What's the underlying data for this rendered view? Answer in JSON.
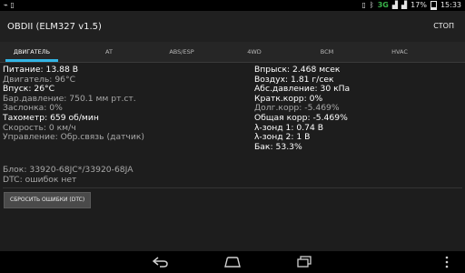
{
  "status_bar": {
    "battery_percent": "17%",
    "time": "15:33",
    "network": "3G"
  },
  "app": {
    "title": "OBDII (ELM327 v1.5)",
    "stop_label": "СТОП"
  },
  "tabs": [
    {
      "label": "ДВИГАТЕЛЬ",
      "active": true
    },
    {
      "label": "AT"
    },
    {
      "label": "ABS/ESP"
    },
    {
      "label": "4WD"
    },
    {
      "label": "BCM"
    },
    {
      "label": "HVAC"
    }
  ],
  "left_column": [
    "Питание: 13.88 В",
    "Двигатель: 96°C",
    "Впуск: 26°C",
    "Бар.давление: 750.1 мм рт.ст.",
    "Заслонка: 0%",
    "Тахометр: 659 об/мин",
    "Скорость: 0 км/ч",
    "Управление: Обр.связь (датчик)"
  ],
  "right_column": [
    "Впрыск: 2.468 мсек",
    "Воздух: 1.81 г/сек",
    "Абс.давление: 30 кПа",
    "Кратк.корр: 0%",
    "Долг.корр: -5.469%",
    "Общая корр: -5.469%",
    "λ-зонд 1: 0.74 В",
    "λ-зонд 2: 1 В",
    "Бак: 53.3%"
  ],
  "block_info": "Блок: 33920-68JC*/33920-68JA",
  "dtc_info": "DTC: ошибок нет",
  "reset_button": "СБРОСИТЬ ОШИБКИ (DTC)"
}
